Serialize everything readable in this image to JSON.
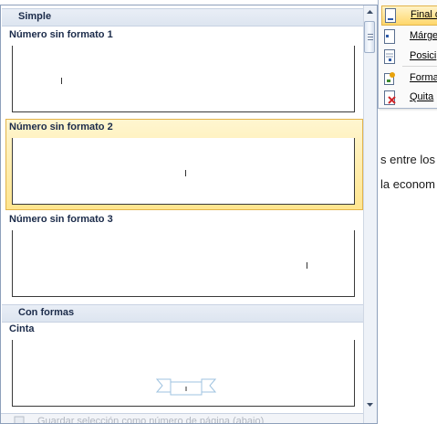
{
  "background_doc": {
    "line1": "s entre los",
    "line2": "la econom"
  },
  "context_menu": {
    "items": [
      {
        "label": "Final d",
        "icon": "page-bottom-icon",
        "highlighted": true
      },
      {
        "label": "Márge",
        "icon": "page-margins-icon",
        "highlighted": false
      },
      {
        "label": "Posici",
        "icon": "current-position-icon",
        "highlighted": false
      },
      {
        "label": "Forma",
        "icon": "format-page-numbers-icon",
        "highlighted": false
      },
      {
        "label": "Quita",
        "icon": "remove-page-numbers-icon",
        "highlighted": false
      }
    ]
  },
  "gallery": {
    "sections": [
      {
        "header": "Simple"
      },
      {
        "header": "Con formas"
      }
    ],
    "items": [
      {
        "title": "Número sin formato 1",
        "align": "left"
      },
      {
        "title": "Número sin formato 2",
        "align": "center"
      },
      {
        "title": "Número sin formato 3",
        "align": "right"
      },
      {
        "title": "Cinta",
        "align": "center"
      }
    ],
    "footer_label": "Guardar selección como número de página (abajo)"
  },
  "colors": {
    "section_header_bg": "#dde5f0",
    "highlight_bg": "#ffe58f",
    "highlight_border": "#e3b44a",
    "gallery_border": "#8ea0bb"
  }
}
